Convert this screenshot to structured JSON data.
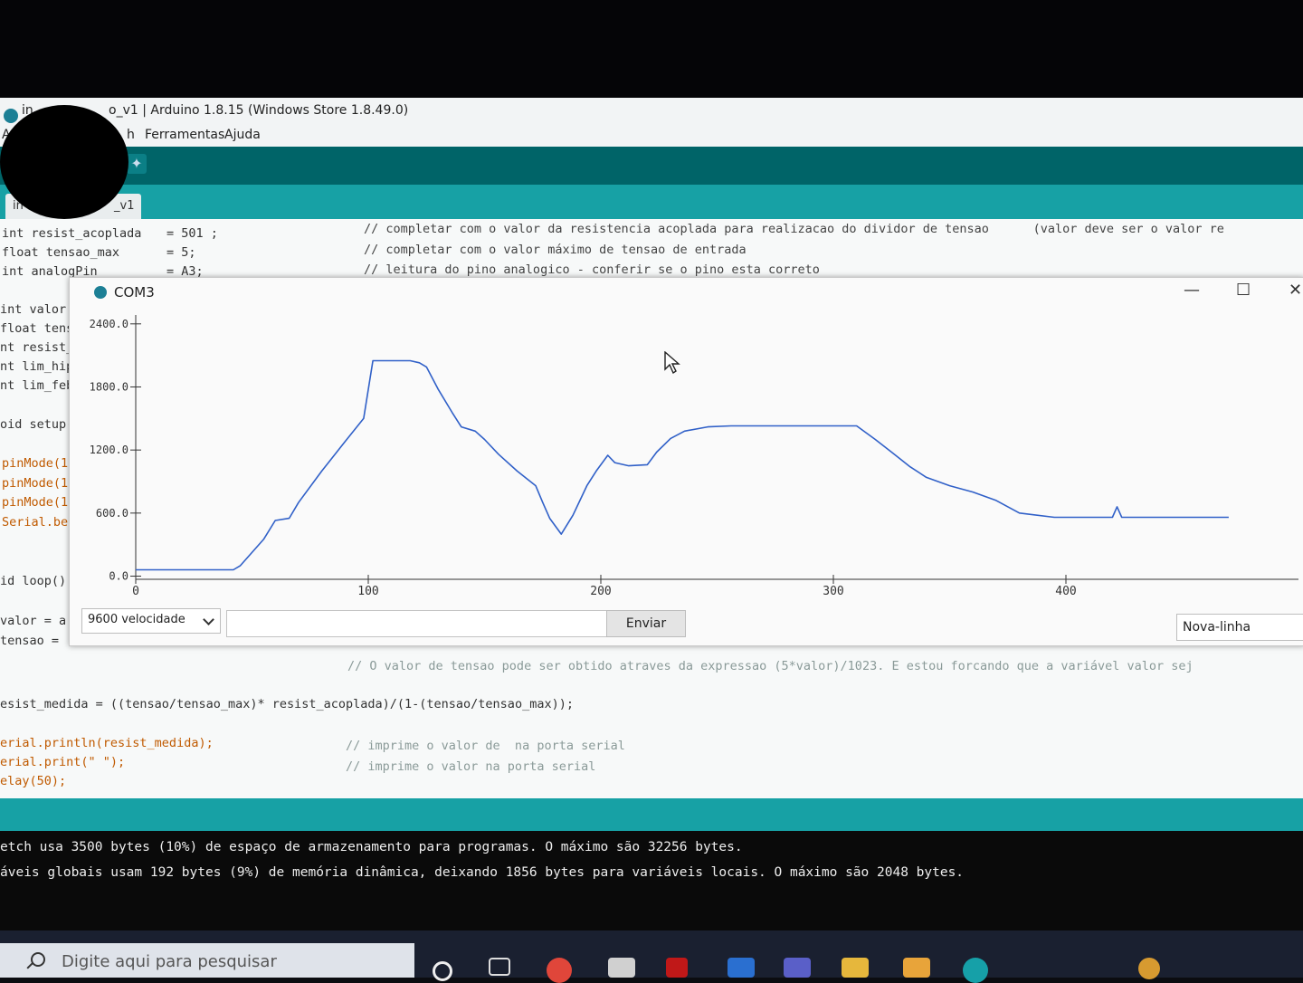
{
  "ide": {
    "title_left": "in",
    "title": "o_v1 | Arduino 1.8.15 (Windows Store 1.8.49.0)",
    "menu": [
      "Ar",
      "h",
      "Ferramentas",
      "Ajuda"
    ],
    "tab_label": "in",
    "tab_label_suffix": "_v1",
    "code_top": [
      {
        "text": "int resist_acoplada",
        "value": "= 501 ;",
        "comment": "// completar com o valor da resistencia acoplada para realizacao do dividor de tensao      (valor deve ser o valor re"
      },
      {
        "text": "float tensao_max",
        "value": "= 5;",
        "comment": "// completar com o valor máximo de tensao de entrada"
      },
      {
        "text": "int analogPin",
        "value": "= A3;",
        "comment": "// leitura do pino analogico - conferir se o pino esta correto"
      }
    ],
    "code_left": [
      "int valor",
      "float tensa",
      "nt resist_",
      "nt lim_hip",
      "nt lim_feb",
      "oid setup(",
      "pinMode(1",
      "pinMode(1",
      "pinMode(1",
      "Serial.be",
      "id loop()",
      "valor = a",
      "tensao ="
    ],
    "code_bottom": [
      "// O valor de tensao pode ser obtido atraves da expressao (5*valor)/1023. E estou forcando que a variável valor sej",
      "esist_medida = ((tensao/tensao_max)* resist_acoplada)/(1-(tensao/tensao_max));",
      "erial.println(resist_medida);",
      "// imprime o valor de  na porta serial",
      "erial.print(\" \");",
      "// imprime o valor na porta serial",
      "elay(50);"
    ],
    "console": [
      "etch usa 3500 bytes (10%) de espaço de armazenamento para programas. O máximo são 32256 bytes.",
      "áveis globais usam 192 bytes (9%) de memória dinâmica, deixando 1856 bytes para variáveis locais. O máximo são 2048 bytes."
    ]
  },
  "serial_plotter": {
    "window_title": "COM3",
    "baud_label": "9600 velocidade",
    "send_label": "Enviar",
    "send_input_value": "",
    "line_ending": "Nova-linha",
    "buttons": {
      "minimize": "—",
      "maximize": "☐",
      "close": "✕"
    }
  },
  "chart_data": {
    "type": "line",
    "title": "",
    "xlabel": "",
    "ylabel": "",
    "xlim": [
      0,
      500
    ],
    "ylim": [
      -30,
      2450
    ],
    "y_ticks": [
      "2400.0",
      "1800.0",
      "1200.0",
      "600.0",
      "0.0"
    ],
    "y_tick_values": [
      2400,
      1800,
      1200,
      600,
      0
    ],
    "x_ticks": [
      "0",
      "100",
      "200",
      "300",
      "400"
    ],
    "x_tick_values": [
      0,
      100,
      200,
      300,
      400
    ],
    "grid": false,
    "series_color": "#3060c8",
    "series": [
      {
        "points": [
          [
            0,
            60
          ],
          [
            20,
            60
          ],
          [
            42,
            60
          ],
          [
            45,
            100
          ],
          [
            55,
            350
          ],
          [
            60,
            530
          ],
          [
            66,
            550
          ],
          [
            70,
            700
          ],
          [
            80,
            1000
          ],
          [
            90,
            1280
          ],
          [
            98,
            1500
          ],
          [
            102,
            2050
          ],
          [
            110,
            2050
          ],
          [
            118,
            2050
          ],
          [
            122,
            2030
          ],
          [
            125,
            1990
          ],
          [
            130,
            1780
          ],
          [
            136,
            1560
          ],
          [
            140,
            1420
          ],
          [
            146,
            1380
          ],
          [
            150,
            1300
          ],
          [
            156,
            1160
          ],
          [
            164,
            1000
          ],
          [
            172,
            860
          ],
          [
            175,
            700
          ],
          [
            178,
            550
          ],
          [
            183,
            400
          ],
          [
            188,
            580
          ],
          [
            194,
            860
          ],
          [
            198,
            1000
          ],
          [
            203,
            1150
          ],
          [
            206,
            1080
          ],
          [
            212,
            1050
          ],
          [
            220,
            1060
          ],
          [
            224,
            1180
          ],
          [
            230,
            1310
          ],
          [
            236,
            1380
          ],
          [
            246,
            1420
          ],
          [
            256,
            1430
          ],
          [
            270,
            1430
          ],
          [
            280,
            1430
          ],
          [
            300,
            1430
          ],
          [
            310,
            1430
          ],
          [
            318,
            1300
          ],
          [
            325,
            1180
          ],
          [
            333,
            1040
          ],
          [
            340,
            940
          ],
          [
            350,
            860
          ],
          [
            360,
            800
          ],
          [
            370,
            720
          ],
          [
            380,
            600
          ],
          [
            395,
            560
          ],
          [
            410,
            560
          ],
          [
            420,
            560
          ],
          [
            422,
            660
          ],
          [
            424,
            560
          ],
          [
            430,
            560
          ],
          [
            440,
            560
          ],
          [
            450,
            560
          ],
          [
            460,
            560
          ],
          [
            470,
            560
          ]
        ]
      }
    ]
  },
  "taskbar": {
    "search_placeholder": "Digite aqui para pesquisar"
  }
}
